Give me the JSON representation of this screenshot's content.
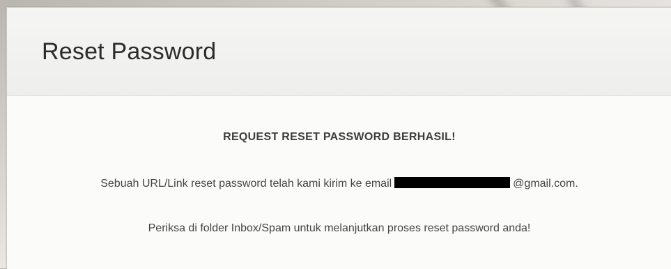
{
  "card": {
    "title": "Reset Password",
    "heading": "REQUEST RESET PASSWORD BERHASIL!",
    "message_prefix": "Sebuah URL/Link reset password telah kami kirim ke email",
    "email_suffix": "@gmail.com.",
    "instruction": "Periksa di folder Inbox/Spam untuk melanjutkan proses reset password anda!"
  }
}
